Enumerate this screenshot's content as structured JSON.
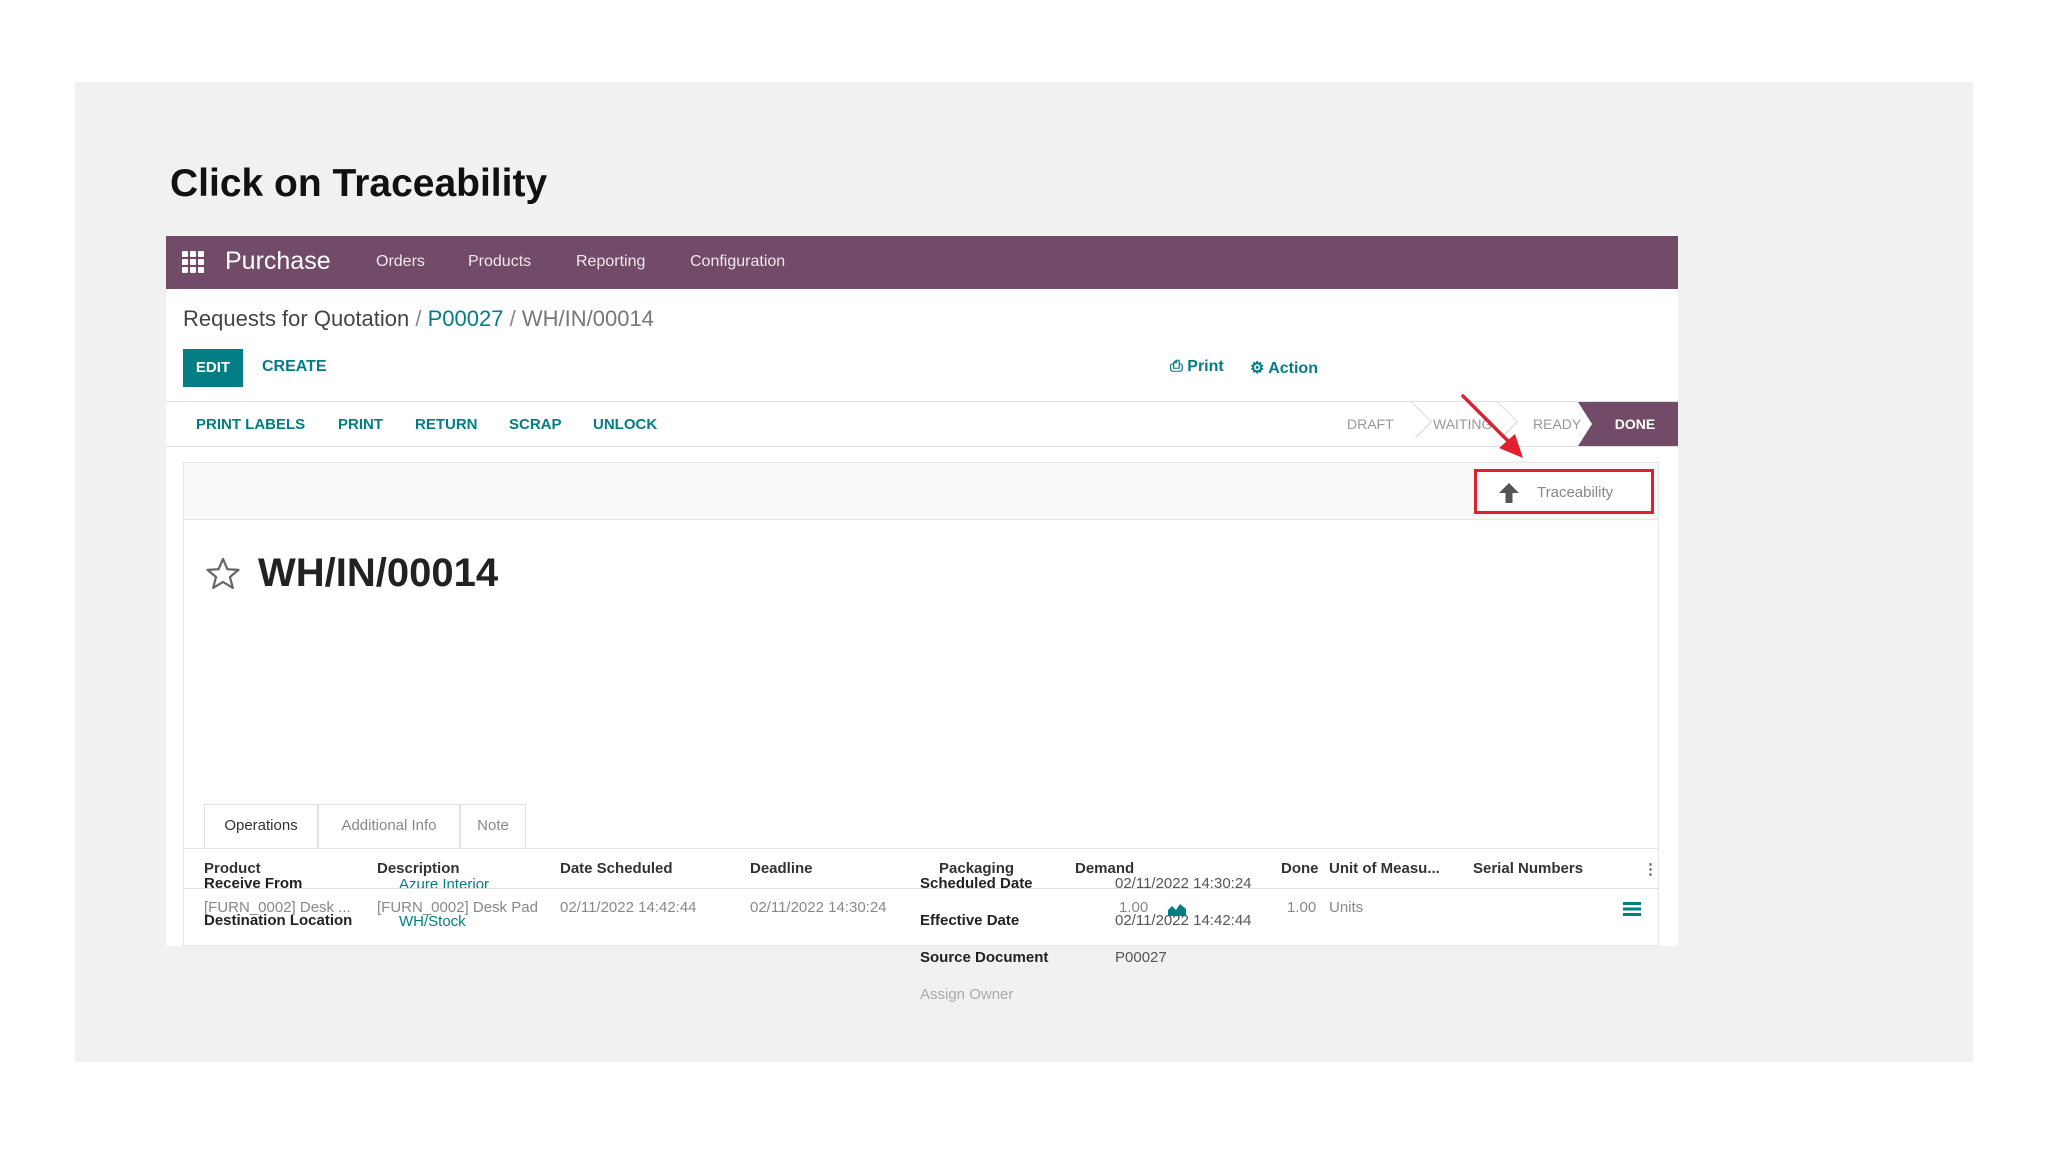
{
  "instruction": "Click on Traceability",
  "navbar": {
    "app_name": "Purchase",
    "menu": [
      "Orders",
      "Products",
      "Reporting",
      "Configuration"
    ]
  },
  "breadcrumb": {
    "root": "Requests for Quotation",
    "sep": "/",
    "parent": "P00027",
    "current": "WH/IN/00014"
  },
  "control": {
    "edit": "EDIT",
    "create": "CREATE",
    "print": "Print",
    "action": "Action"
  },
  "statusbar": {
    "buttons": [
      "PRINT LABELS",
      "PRINT",
      "RETURN",
      "SCRAP",
      "UNLOCK"
    ],
    "stages": [
      "DRAFT",
      "WAITING",
      "READY",
      "DONE"
    ],
    "active_stage": "DONE"
  },
  "smart_button": {
    "label": "Traceability",
    "icon": "arrow-up-icon"
  },
  "record": {
    "title": "WH/IN/00014",
    "left_fields": [
      {
        "label": "Receive From",
        "value": "Azure Interior"
      },
      {
        "label": "Destination Location",
        "value": "WH/Stock"
      }
    ],
    "right_fields": [
      {
        "label": "Scheduled Date",
        "value": "02/11/2022 14:30:24"
      },
      {
        "label": "Effective Date",
        "value": "02/11/2022 14:42:44"
      },
      {
        "label": "Source Document",
        "value": "P00027"
      },
      {
        "label": "Assign Owner",
        "value": ""
      }
    ]
  },
  "tabs": [
    "Operations",
    "Additional Info",
    "Note"
  ],
  "table": {
    "columns": [
      "Product",
      "Description",
      "Date Scheduled",
      "Deadline",
      "Packaging",
      "Demand",
      "Done",
      "Unit of Measu...",
      "Serial Numbers"
    ],
    "rows": [
      {
        "product": "[FURN_0002] Desk ...",
        "description": "[FURN_0002] Desk Pad",
        "date_scheduled": "02/11/2022 14:42:44",
        "deadline": "02/11/2022 14:30:24",
        "packaging": "",
        "demand": "1.00",
        "done": "1.00",
        "uom": "Units"
      }
    ]
  },
  "colors": {
    "brand": "#714b67",
    "accent": "#017e84",
    "highlight": "#e02030"
  }
}
